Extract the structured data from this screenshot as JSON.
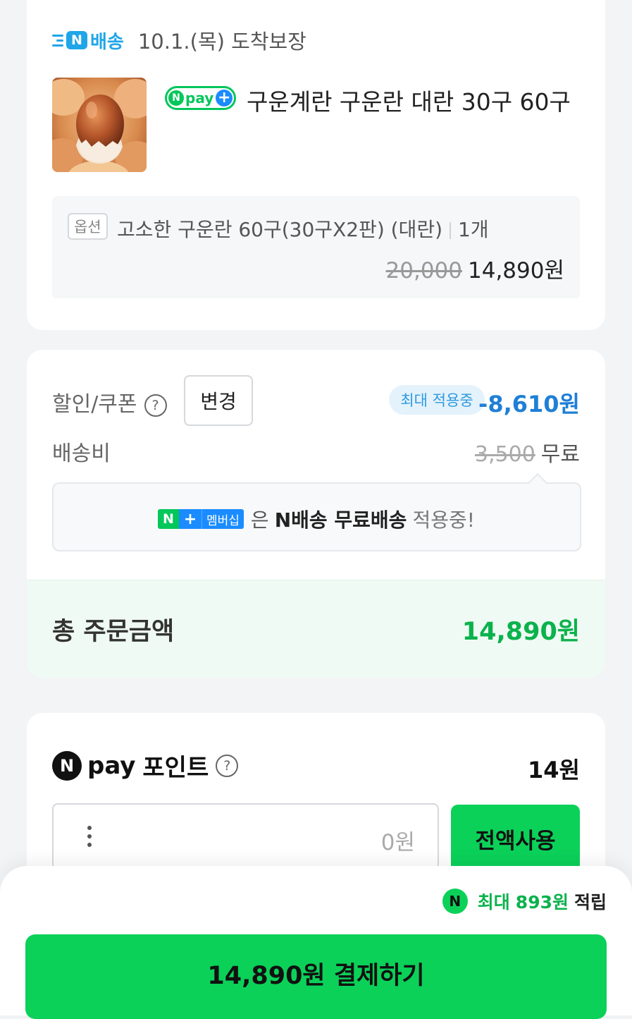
{
  "delivery": {
    "badge_text": "배송",
    "badge_n": "N",
    "arrival": "10.1.(목) 도착보장"
  },
  "product": {
    "npay_badge_n": "N",
    "npay_badge_text": "pay",
    "npay_badge_plus": "+",
    "name": "구운계란 구운란 대란 30구 60구",
    "thumbnail_icon": "boiled-egg-photo"
  },
  "option": {
    "tag": "옵션",
    "name": "고소한 구운란 60구(30구X2판) (대란)",
    "quantity": "1개",
    "original_price": "20,000",
    "price": "14,890원"
  },
  "summary": {
    "discount_label": "할인/쿠폰",
    "help_glyph": "?",
    "change_button": "변경",
    "max_applied_badge": "최대 적용중",
    "discount_value": "-8,610원",
    "shipping_label": "배송비",
    "shipping_original": "3,500",
    "shipping_value": "무료",
    "membership": {
      "badge_n": "N",
      "badge_plus": "+",
      "badge_text": "멤버십",
      "text1": "은",
      "text2": "N배송 무료배송",
      "text3": "적용중!"
    },
    "total_label": "총 주문금액",
    "total_value": "14,890원"
  },
  "points": {
    "logo_n": "N",
    "logo_pay": "pay",
    "label": "포인트",
    "help_glyph": "?",
    "balance": "14원",
    "input_placeholder": "0원",
    "use_all_button": "전액사용"
  },
  "bottom": {
    "reward_icon": "N",
    "reward_prefix": "최대",
    "reward_amount": "893원",
    "reward_suffix": "적립",
    "pay_button": "14,890원 결제하기"
  },
  "colors": {
    "naver_green": "#03c75a",
    "button_green": "#0bd159",
    "discount_blue": "#1f7fd6",
    "delivery_blue": "#1fa6e8"
  }
}
